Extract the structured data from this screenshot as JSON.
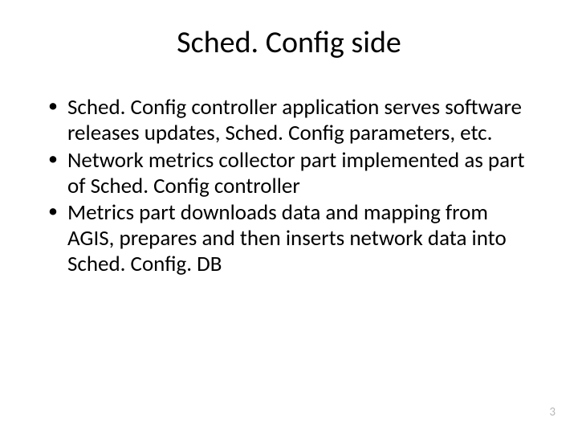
{
  "slide": {
    "title": "Sched. Config side",
    "bullets": [
      "Sched. Config controller application serves software releases updates, Sched. Config parameters, etc.",
      "Network metrics collector part implemented as part of Sched. Config controller",
      "Metrics part downloads data and mapping from AGIS, prepares and then inserts network data into Sched. Config. DB"
    ],
    "pageNumber": "3"
  }
}
